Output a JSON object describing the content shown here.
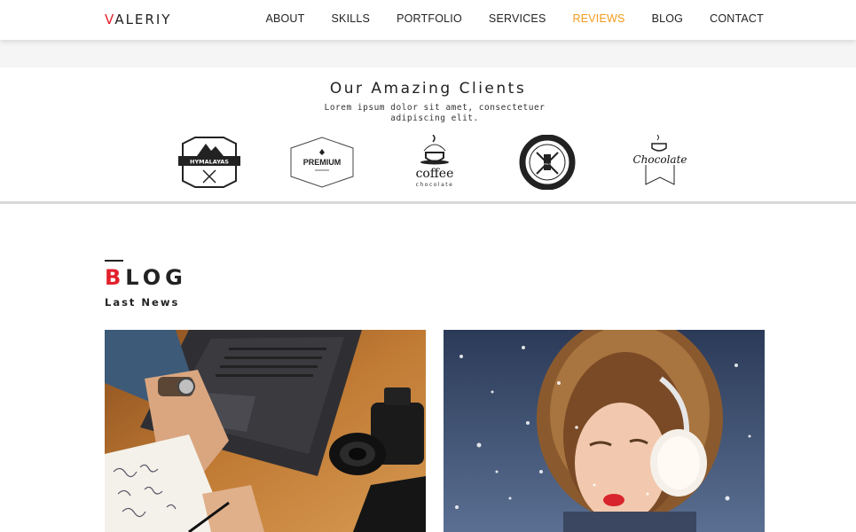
{
  "brand": {
    "logo_first": "V",
    "logo_rest": "ALERIY",
    "accent": "#e2202c",
    "active_color": "#f29b1d"
  },
  "nav": {
    "items": [
      {
        "label": "ABOUT"
      },
      {
        "label": "SKILLS"
      },
      {
        "label": "PORTFOLIO"
      },
      {
        "label": "SERVICES"
      },
      {
        "label": "REVIEWS",
        "active": true
      },
      {
        "label": "BLOG"
      },
      {
        "label": "CONTACT"
      }
    ]
  },
  "clients": {
    "title": "Our Amazing Clients",
    "subtitle": "Lorem ipsum dolor sit amet, consectetuer adipiscing elit.",
    "logos": [
      {
        "name": "himalayas-logo",
        "text": "HYMALAYAS"
      },
      {
        "name": "premium-logo",
        "text": "PREMIUM"
      },
      {
        "name": "coffee-logo",
        "text": "coffee",
        "subtext": "chocolate"
      },
      {
        "name": "minneapolis-logo",
        "text": "MINNEAPOLIS BAKED"
      },
      {
        "name": "chocolate-logo",
        "text": "Chocolate"
      }
    ]
  },
  "blog": {
    "title_first": "B",
    "title_rest": "LOG",
    "subtitle": "Last News",
    "posts": [
      {
        "image": "workspace-laptop-camera-photo"
      },
      {
        "image": "winter-woman-earmuffs-photo"
      }
    ]
  }
}
